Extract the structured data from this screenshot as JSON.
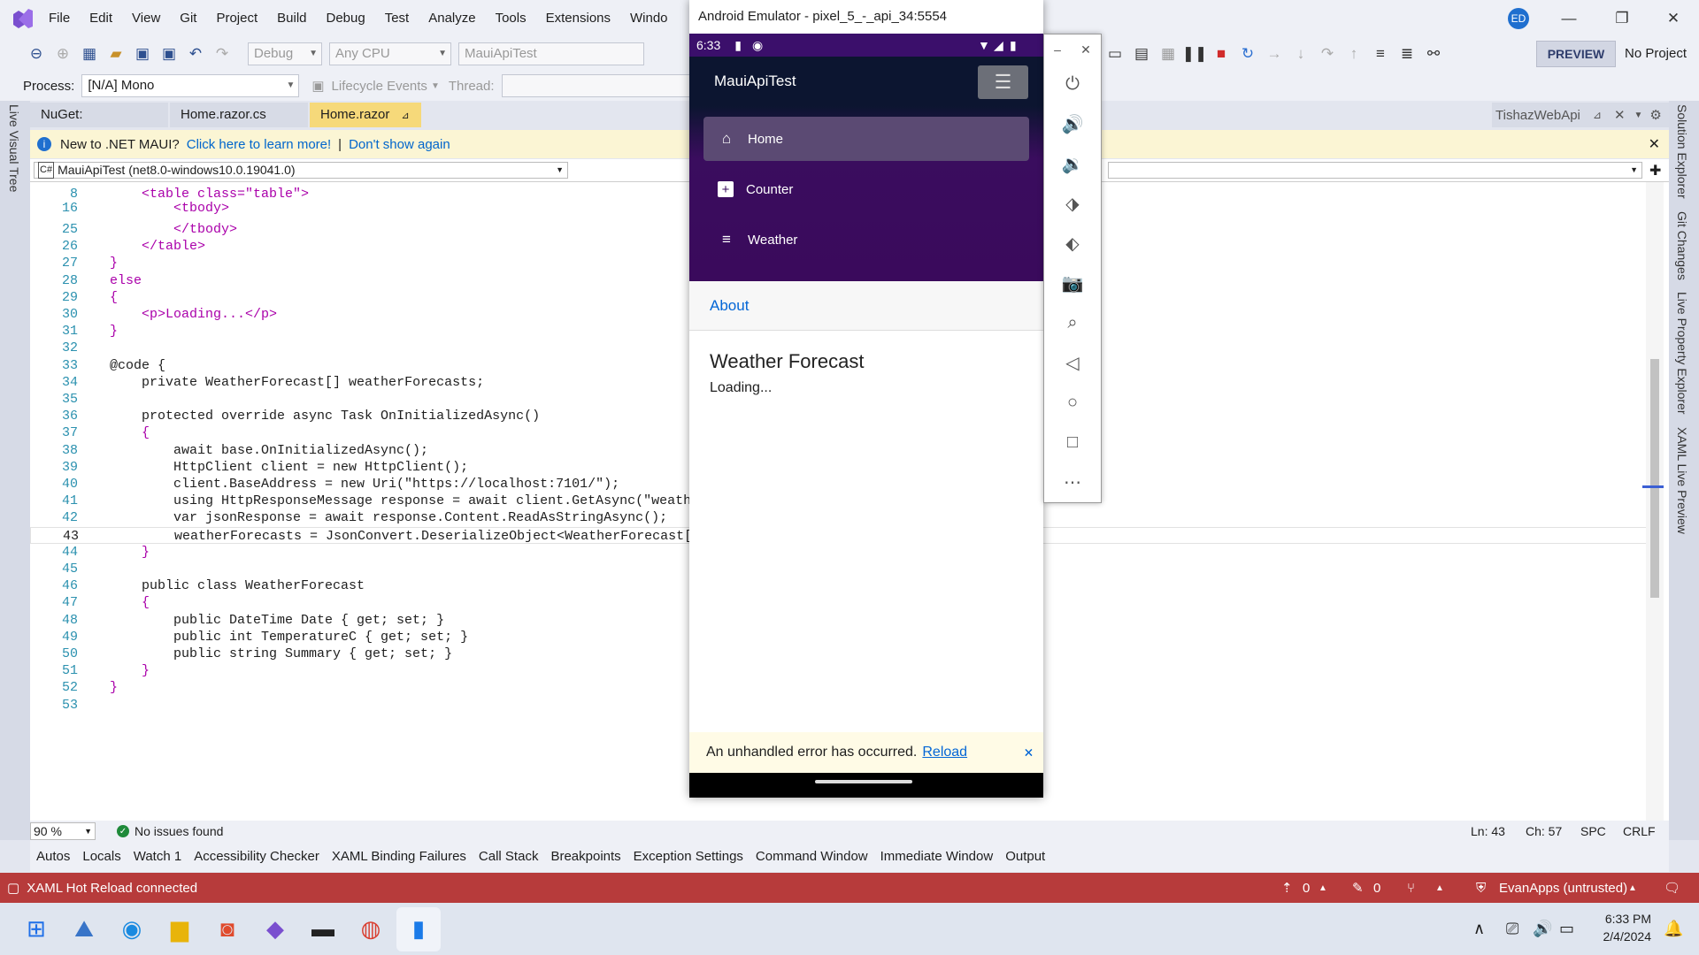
{
  "vs": {
    "menu": [
      "File",
      "Edit",
      "View",
      "Git",
      "Project",
      "Build",
      "Debug",
      "Test",
      "Analyze",
      "Tools",
      "Extensions",
      "Windo"
    ],
    "user_initials": "ED",
    "preview_label": "PREVIEW",
    "no_project": "No Project",
    "config": "Debug",
    "platform": "Any CPU",
    "startup": "MauiApiTest",
    "process_label": "Process:",
    "process_value": "[N/A] Mono",
    "lifecycle_label": "Lifecycle Events",
    "thread_label": "Thread:",
    "tabs": [
      "NuGet: MauiApiTest",
      "Home.razor.cs",
      "Home.razor"
    ],
    "right_tab": "TishazWebApi",
    "info_text": "New to .NET MAUI?",
    "info_link": "Click here to learn more!",
    "info_sep": "|",
    "info_dismiss": "Don't show again",
    "nav_target": "MauiApiTest (net8.0-windows10.0.19041.0)",
    "live_visual_tree": "Live Visual Tree",
    "right_panels": [
      "Solution Explorer",
      "Git Changes",
      "Live Property Explorer",
      "XAML Live Preview"
    ],
    "zoom": "90 %",
    "issues": "No issues found",
    "ln": "Ln: 43",
    "ch": "Ch: 57",
    "spc": "SPC",
    "crlf": "CRLF",
    "bottom_tabs": [
      "Autos",
      "Locals",
      "Watch 1",
      "Accessibility Checker",
      "XAML Binding Failures",
      "Call Stack",
      "Breakpoints",
      "Exception Settings",
      "Command Window",
      "Immediate Window",
      "Output"
    ],
    "status": "XAML Hot Reload connected",
    "status_up": "0",
    "status_pen": "0",
    "status_repo": "EvanApps (untrusted)",
    "time": "6:33 PM",
    "date": "2/4/2024"
  },
  "code": [
    {
      "n": "8",
      "t": "<table class=\"table\">",
      "indent": 4
    },
    {
      "n": "16",
      "t": "<tbody>",
      "indent": 8
    },
    {
      "n": "25",
      "t": "</tbody>",
      "indent": 8
    },
    {
      "n": "26",
      "t": "</table>",
      "indent": 4
    },
    {
      "n": "27",
      "t": "}",
      "indent": 0
    },
    {
      "n": "28",
      "t": "else",
      "indent": 0
    },
    {
      "n": "29",
      "t": "{",
      "indent": 0
    },
    {
      "n": "30",
      "t": "<p>Loading...</p>",
      "indent": 4
    },
    {
      "n": "31",
      "t": "}",
      "indent": 0
    },
    {
      "n": "32",
      "t": "",
      "indent": 0
    },
    {
      "n": "33",
      "t": "@code {",
      "indent": 0
    },
    {
      "n": "34",
      "t": "private WeatherForecast[] weatherForecasts;",
      "indent": 4
    },
    {
      "n": "35",
      "t": "",
      "indent": 0
    },
    {
      "n": "36",
      "t": "protected override async Task OnInitializedAsync()",
      "indent": 4
    },
    {
      "n": "37",
      "t": "{",
      "indent": 4
    },
    {
      "n": "38",
      "t": "await base.OnInitializedAsync();",
      "indent": 8
    },
    {
      "n": "39",
      "t": "HttpClient client = new HttpClient();",
      "indent": 8
    },
    {
      "n": "40",
      "t": "client.BaseAddress = new Uri(\"https://localhost:7101/\");",
      "indent": 8
    },
    {
      "n": "41",
      "t": "using HttpResponseMessage response = await client.GetAsync(\"weathe",
      "indent": 8
    },
    {
      "n": "42",
      "t": "var jsonResponse = await response.Content.ReadAsStringAsync();",
      "indent": 8
    },
    {
      "n": "43",
      "t": "weatherForecasts = JsonConvert.DeserializeObject<WeatherForecast[]",
      "indent": 8
    },
    {
      "n": "44",
      "t": "}",
      "indent": 4
    },
    {
      "n": "45",
      "t": "",
      "indent": 0
    },
    {
      "n": "46",
      "t": "public class WeatherForecast",
      "indent": 4
    },
    {
      "n": "47",
      "t": "{",
      "indent": 4
    },
    {
      "n": "48",
      "t": "public DateTime Date { get; set; }",
      "indent": 8
    },
    {
      "n": "49",
      "t": "public int TemperatureC { get; set; }",
      "indent": 8
    },
    {
      "n": "50",
      "t": "public string Summary { get; set; }",
      "indent": 8
    },
    {
      "n": "51",
      "t": "}",
      "indent": 4
    },
    {
      "n": "52",
      "t": "}",
      "indent": 0
    },
    {
      "n": "53",
      "t": "",
      "indent": 0
    }
  ],
  "emulator": {
    "title": "Android Emulator - pixel_5_-_api_34:5554",
    "phone_time": "6:33",
    "app_title": "MauiApiTest",
    "nav": [
      "Home",
      "Counter",
      "Weather"
    ],
    "about": "About",
    "heading": "Weather Forecast",
    "loading": "Loading...",
    "error_text": "An unhandled error has occurred.",
    "error_link": "Reload",
    "error_close": "🗙"
  }
}
